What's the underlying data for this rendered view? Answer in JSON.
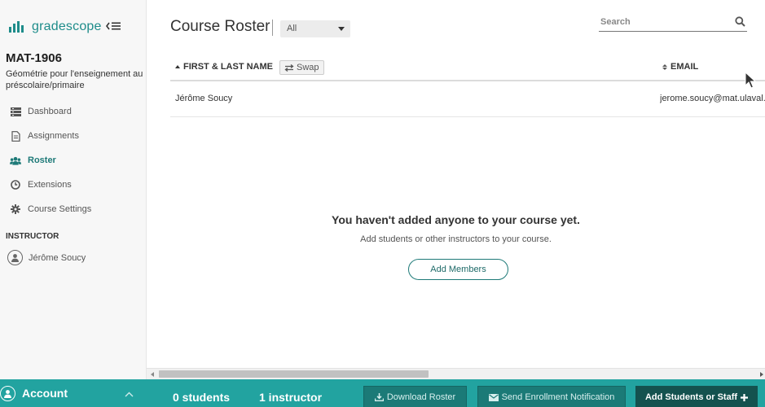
{
  "brand": {
    "name": "gradescope",
    "color": "#1e8c8a"
  },
  "course": {
    "code": "MAT-1906",
    "name": "Géométrie pour l'enseignement au préscolaire/primaire"
  },
  "nav": {
    "items": [
      {
        "label": "Dashboard",
        "icon": "dashboard-icon"
      },
      {
        "label": "Assignments",
        "icon": "document-icon"
      },
      {
        "label": "Roster",
        "icon": "users-icon",
        "active": true
      },
      {
        "label": "Extensions",
        "icon": "clock-icon"
      },
      {
        "label": "Course Settings",
        "icon": "gear-icon"
      }
    ]
  },
  "instructors": {
    "section_label": "INSTRUCTOR",
    "name": "Jérôme Soucy"
  },
  "header": {
    "title": "Course Roster",
    "filter_value": "All",
    "search_placeholder": "Search"
  },
  "table": {
    "columns": {
      "name": "FIRST & LAST NAME",
      "swap": "Swap",
      "email": "EMAIL"
    },
    "rows": [
      {
        "name": "Jérôme Soucy",
        "email": "jerome.soucy@mat.ulaval.c"
      }
    ]
  },
  "empty_state": {
    "title": "You haven't added anyone to your course yet.",
    "subtitle": "Add students or other instructors to your course.",
    "button": "Add Members"
  },
  "footer": {
    "account_label": "Account",
    "students": "0 students",
    "instructors": "1 instructor",
    "download": "Download Roster",
    "notify": "Send Enrollment Notification",
    "add": "Add Students or Staff",
    "bar_color": "#22a3a0"
  }
}
